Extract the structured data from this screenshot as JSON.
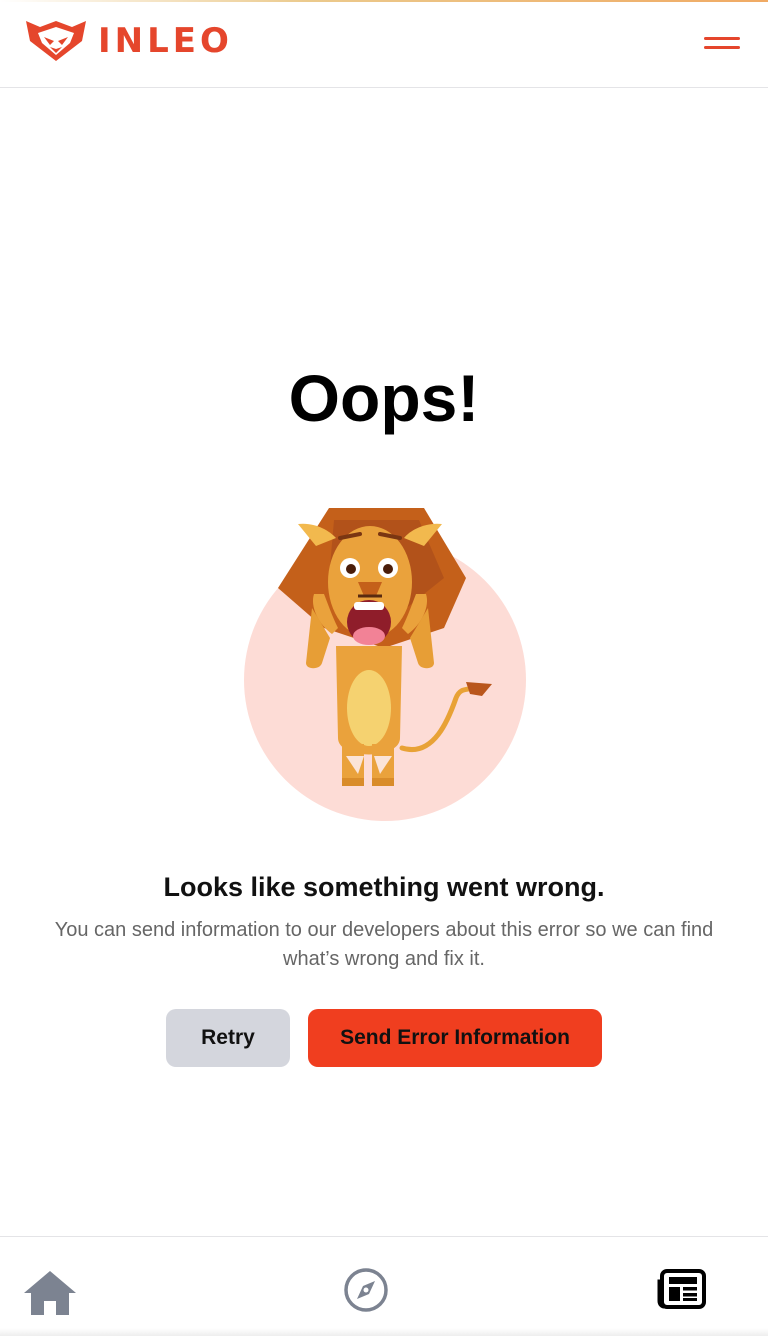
{
  "brand": {
    "name": "INLEO",
    "logo_icon": "lion-head-logo-icon",
    "accent_color": "#e5462c"
  },
  "header": {
    "menu_icon": "hamburger-menu-icon"
  },
  "error_page": {
    "title": "Oops!",
    "illustration": "scared-lion-illustration",
    "heading": "Looks like something went wrong.",
    "description": "You can send information to our developers about this error so we can find what’s wrong and fix it.",
    "retry_label": "Retry",
    "send_label": "Send Error Information",
    "send_button_color": "#f03e1f",
    "retry_button_color": "#d4d6dd"
  },
  "bottom_nav": {
    "items": [
      {
        "name": "home",
        "icon": "home-icon"
      },
      {
        "name": "explore",
        "icon": "compass-icon"
      },
      {
        "name": "news",
        "icon": "newspaper-icon"
      }
    ]
  }
}
